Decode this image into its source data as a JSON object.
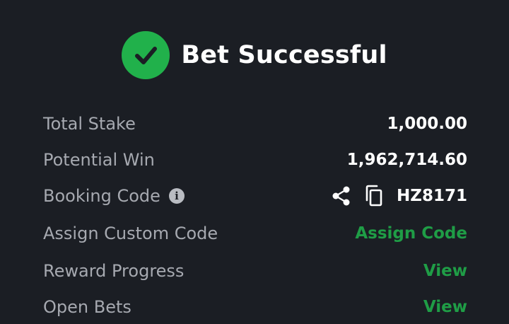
{
  "header": {
    "title": "Bet Successful",
    "icon": "check-circle-icon",
    "icon_color": "#21b14b"
  },
  "details": {
    "total_stake": {
      "label": "Total Stake",
      "value": "1,000.00"
    },
    "potential_win": {
      "label": "Potential Win",
      "value": "1,962,714.60"
    },
    "booking_code": {
      "label": "Booking Code",
      "info_icon": "info-icon",
      "share_icon": "share-icon",
      "copy_icon": "copy-icon",
      "value": "HZ8171"
    },
    "assign_custom_code": {
      "label": "Assign Custom Code",
      "action": "Assign Code"
    },
    "reward_progress": {
      "label": "Reward Progress",
      "action": "View"
    },
    "open_bets": {
      "label": "Open Bets",
      "action": "View"
    }
  },
  "colors": {
    "background": "#1b1e24",
    "label": "#a6a9b0",
    "value": "#ffffff",
    "accent_green": "#1f9d46"
  }
}
